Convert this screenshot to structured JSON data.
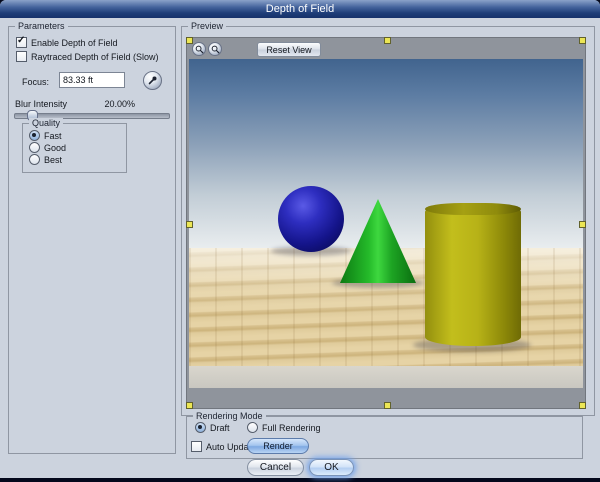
{
  "window": {
    "title": "Depth of Field"
  },
  "parameters": {
    "group_label": "Parameters",
    "enable_dof": {
      "label": "Enable Depth of Field",
      "checked": true
    },
    "raytraced_dof": {
      "label": "Raytraced Depth of Field (Slow)",
      "checked": false
    },
    "focus": {
      "label": "Focus:",
      "value": "83.33 ft"
    },
    "focus_pick_icon": "eyedropper",
    "blur_intensity": {
      "label": "Blur Intensity",
      "value": "20.00%",
      "slider_position_percent": 13
    },
    "quality": {
      "group_label": "Quality",
      "options": [
        {
          "label": "Fast",
          "selected": true
        },
        {
          "label": "Good",
          "selected": false
        },
        {
          "label": "Best",
          "selected": false
        }
      ]
    }
  },
  "preview": {
    "group_label": "Preview",
    "reset_view_button": "Reset View",
    "toolbar_icons": {
      "zoom_out": "magnifier",
      "zoom_in": "magnifier"
    },
    "scene": {
      "objects": [
        "blue-sphere",
        "green-cone",
        "yellow-cylinder"
      ],
      "sphere_color": "#1c1c9c",
      "cone_color": "#22b026",
      "cylinder_color": "#b0ab15",
      "floor": "wood-planks",
      "sky_top_color": "#41648e"
    }
  },
  "rendering_mode": {
    "group_label": "Rendering Mode",
    "draft": {
      "label": "Draft",
      "selected": true
    },
    "full_rendering": {
      "label": "Full Rendering",
      "selected": false
    },
    "auto_update": {
      "label": "Auto Update",
      "checked": false
    },
    "render_button": "Render"
  },
  "footer": {
    "cancel_button": "Cancel",
    "ok_button": "OK"
  },
  "colors": {
    "dialog_bg": "#ccd3de",
    "titlebar_blue": "#1e3d78",
    "selection_handle_yellow": "#ece655",
    "render_button_blue": "#7ea9e2"
  }
}
